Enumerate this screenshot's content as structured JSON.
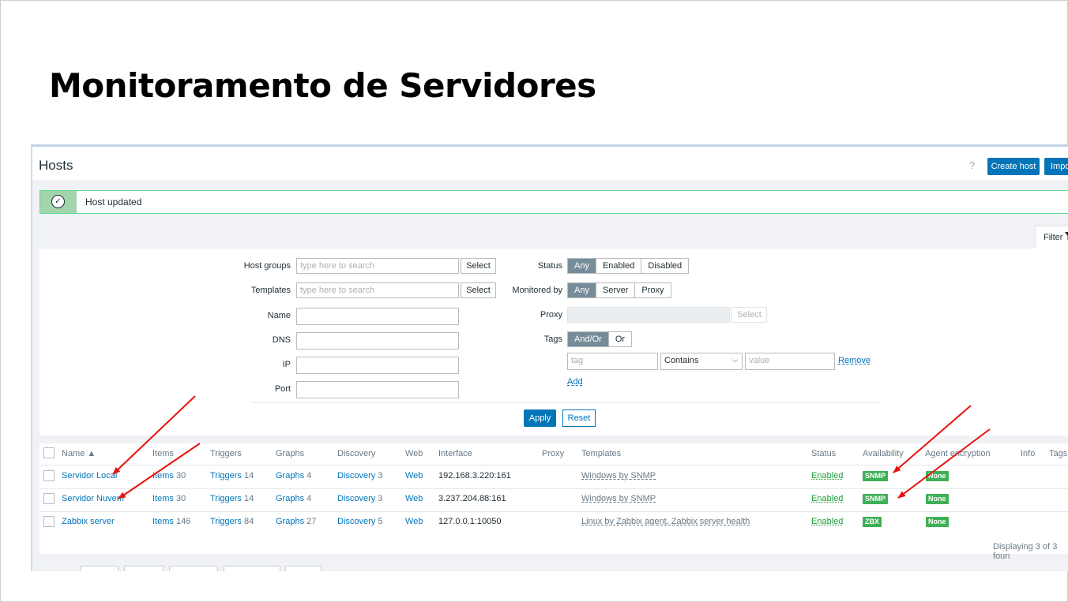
{
  "slide": {
    "title": "Monitoramento de Servidores"
  },
  "header": {
    "title": "Hosts",
    "help": "?",
    "create_host": "Create host",
    "import": "Impo"
  },
  "message": {
    "text": "Host updated",
    "icon": "check-circle-icon"
  },
  "filter": {
    "tab_label": "Filter",
    "host_groups": {
      "label": "Host groups",
      "placeholder": "type here to search",
      "select": "Select"
    },
    "templates": {
      "label": "Templates",
      "placeholder": "type here to search",
      "select": "Select"
    },
    "name_label": "Name",
    "dns_label": "DNS",
    "ip_label": "IP",
    "port_label": "Port",
    "status": {
      "label": "Status",
      "options": [
        "Any",
        "Enabled",
        "Disabled"
      ]
    },
    "monitored_by": {
      "label": "Monitored by",
      "options": [
        "Any",
        "Server",
        "Proxy"
      ]
    },
    "proxy": {
      "label": "Proxy",
      "select": "Select"
    },
    "tags": {
      "label": "Tags",
      "options": [
        "And/Or",
        "Or"
      ],
      "tag_placeholder": "tag",
      "operator": "Contains",
      "value_placeholder": "value",
      "remove": "Remove",
      "add": "Add"
    },
    "apply": "Apply",
    "reset": "Reset"
  },
  "table": {
    "columns": [
      "Name ▲",
      "Items",
      "Triggers",
      "Graphs",
      "Discovery",
      "Web",
      "Interface",
      "Proxy",
      "Templates",
      "Status",
      "Availability",
      "Agent encryption",
      "Info",
      "Tags"
    ],
    "rows": [
      {
        "name": "Servidor Local",
        "items": "Items",
        "items_n": "30",
        "triggers": "Triggers",
        "triggers_n": "14",
        "graphs": "Graphs",
        "graphs_n": "4",
        "discovery": "Discovery",
        "discovery_n": "3",
        "web": "Web",
        "interface": "192.168.3.220:161",
        "templates": "Windows by SNMP",
        "status": "Enabled",
        "availability": "SNMP",
        "encryption": "None"
      },
      {
        "name": "Servidor Nuvem",
        "items": "Items",
        "items_n": "30",
        "triggers": "Triggers",
        "triggers_n": "14",
        "graphs": "Graphs",
        "graphs_n": "4",
        "discovery": "Discovery",
        "discovery_n": "3",
        "web": "Web",
        "interface": "3.237.204.88:161",
        "templates": "Windows by SNMP",
        "status": "Enabled",
        "availability": "SNMP",
        "encryption": "None"
      },
      {
        "name": "Zabbix server",
        "items": "Items",
        "items_n": "146",
        "triggers": "Triggers",
        "triggers_n": "84",
        "graphs": "Graphs",
        "graphs_n": "27",
        "discovery": "Discovery",
        "discovery_n": "5",
        "web": "Web",
        "interface": "127.0.0.1:10050",
        "templates": "Linux by Zabbix agent, Zabbix server health",
        "status": "Enabled",
        "availability": "ZBX",
        "encryption": "None"
      }
    ],
    "footer": "Displaying 3 of 3 foun"
  },
  "colors": {
    "accent": "#0275b8",
    "success": "#3eb057",
    "annotation_arrow": "#e8120c"
  }
}
